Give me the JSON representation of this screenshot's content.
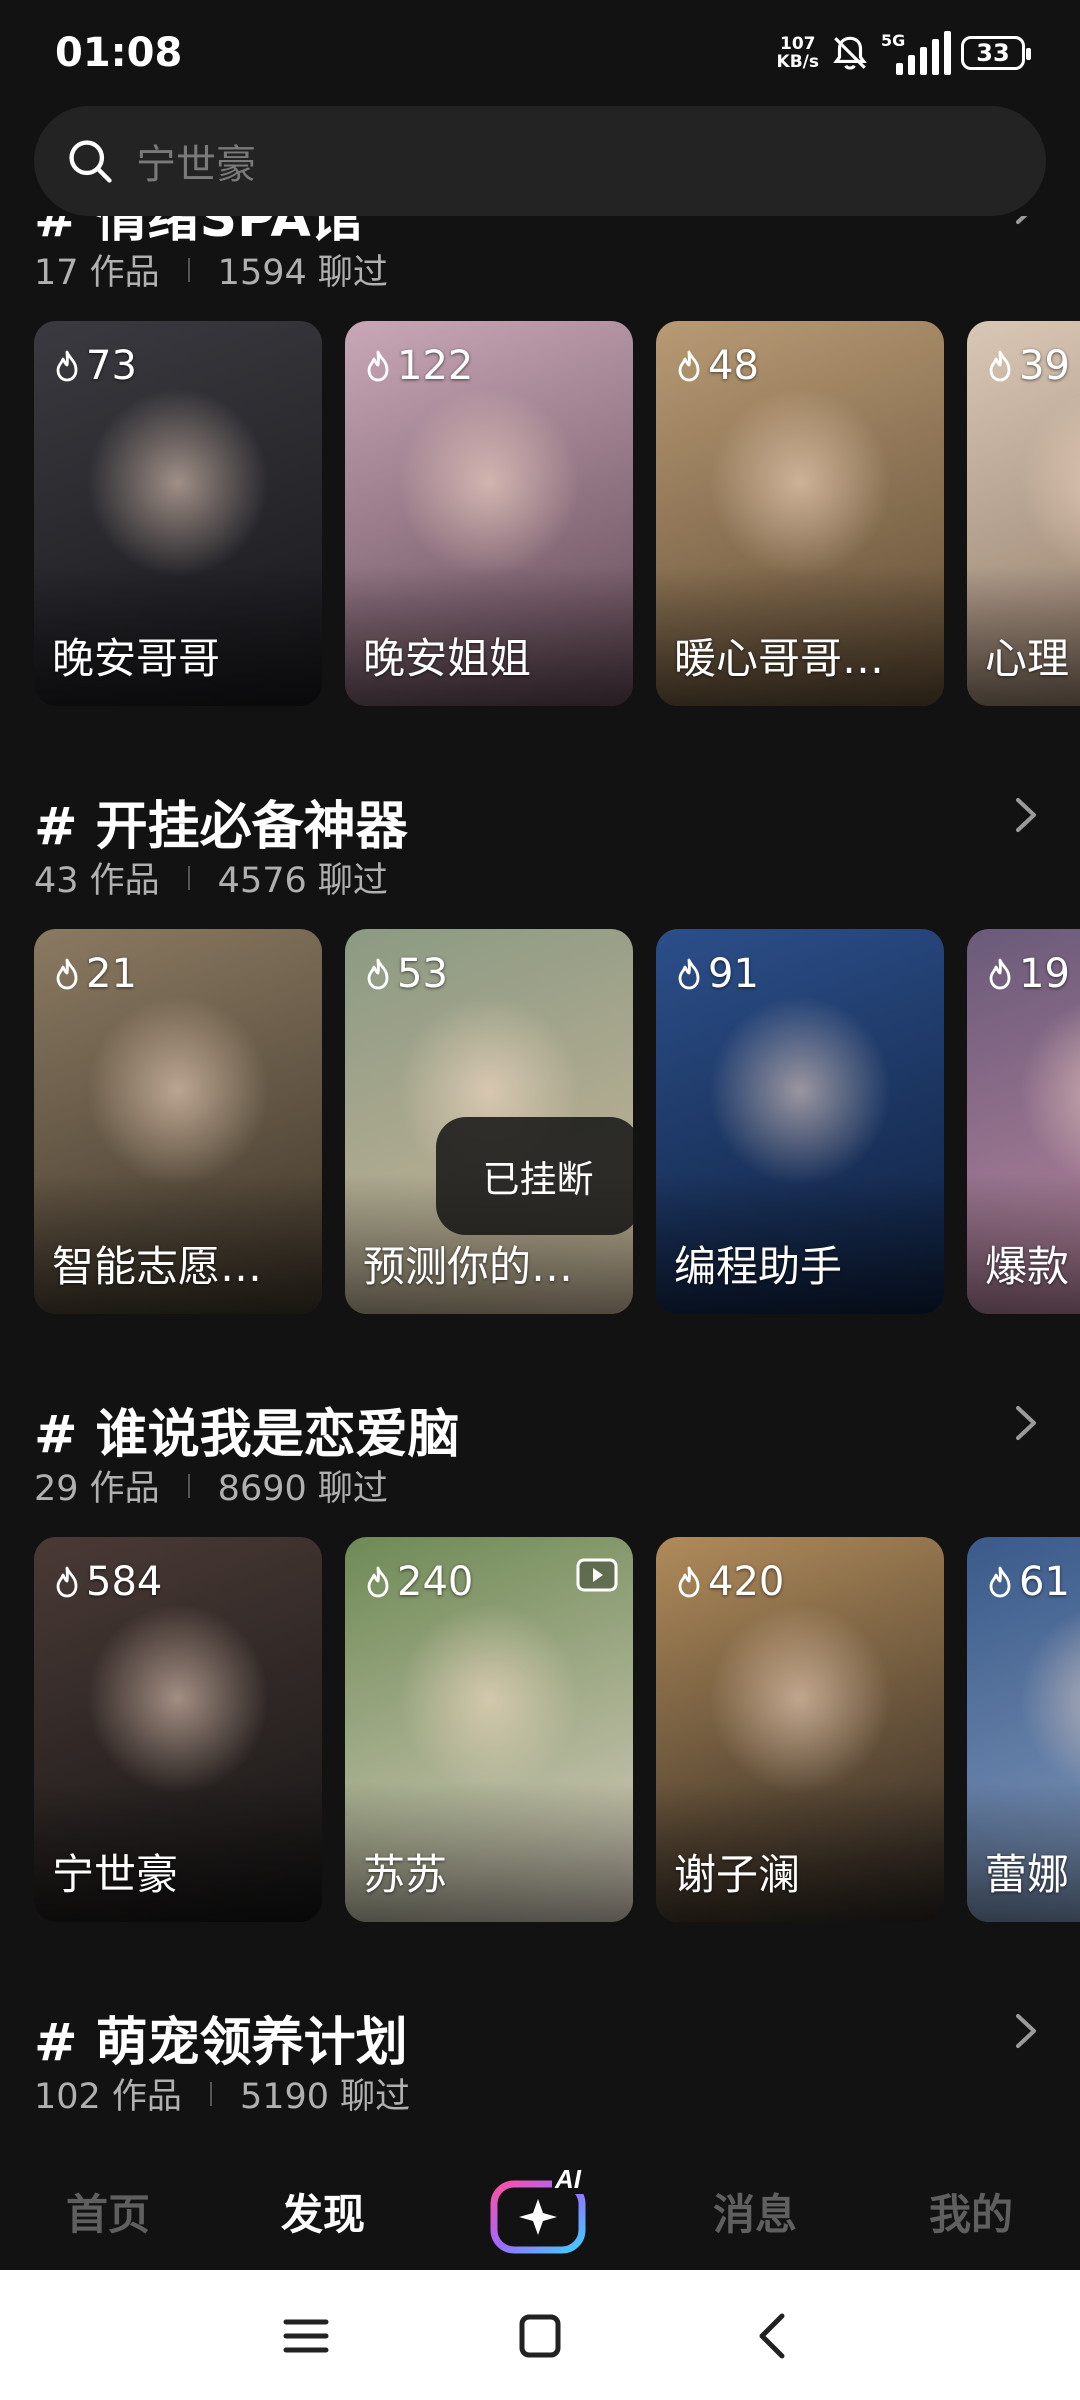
{
  "status_bar": {
    "time": "01:08",
    "net_speed_value": "107",
    "net_speed_unit": "KB/s",
    "network_type": "5G",
    "battery": "33"
  },
  "search": {
    "placeholder": "宁世豪"
  },
  "sections": [
    {
      "title": "# 情绪SPA馆",
      "works": "17 作品",
      "chats": "1594 聊过",
      "cards": [
        {
          "count": "73",
          "name": "晚安哥哥",
          "colors": [
            "#3a3a40",
            "#17171b"
          ]
        },
        {
          "count": "122",
          "name": "晚安姐姐",
          "colors": [
            "#c9a7b6",
            "#5e4652"
          ]
        },
        {
          "count": "48",
          "name": "暖心哥哥…",
          "colors": [
            "#b89a74",
            "#5e4a33"
          ]
        },
        {
          "count": "39",
          "name": "心理",
          "colors": [
            "#d9c7b5",
            "#8a7361"
          ]
        }
      ]
    },
    {
      "title": "# 开挂必备神器",
      "works": "43 作品",
      "chats": "4576 聊过",
      "cards": [
        {
          "count": "21",
          "name": "智能志愿…",
          "colors": [
            "#8b7a62",
            "#3d3428"
          ]
        },
        {
          "count": "53",
          "name": "预测你的…",
          "colors": [
            "#8c9a83",
            "#c9b79a"
          ]
        },
        {
          "count": "91",
          "name": "编程助手",
          "colors": [
            "#2c4f8a",
            "#0e1f3d"
          ]
        },
        {
          "count": "19",
          "name": "爆款",
          "colors": [
            "#6a5a7a",
            "#c08aa0"
          ]
        }
      ]
    },
    {
      "title": "# 谁说我是恋爱脑",
      "works": "29 作品",
      "chats": "8690 聊过",
      "cards": [
        {
          "count": "584",
          "name": "宁世豪",
          "colors": [
            "#4a3a36",
            "#141414"
          ]
        },
        {
          "count": "240",
          "name": "苏苏",
          "colors": [
            "#6e8a56",
            "#d9cfc0"
          ]
        },
        {
          "count": "420",
          "name": "谢子澜",
          "colors": [
            "#b08b5a",
            "#2a2420"
          ]
        },
        {
          "count": "61",
          "name": "蕾娜",
          "colors": [
            "#3a5a8a",
            "#8aa0c0"
          ]
        }
      ]
    },
    {
      "title": "# 萌宠领养计划",
      "works": "102 作品",
      "chats": "5190 聊过",
      "cards": []
    }
  ],
  "toast": "已挂断",
  "tabs": {
    "home": "首页",
    "discover": "发现",
    "ai": "AI",
    "messages": "消息",
    "mine": "我的"
  }
}
